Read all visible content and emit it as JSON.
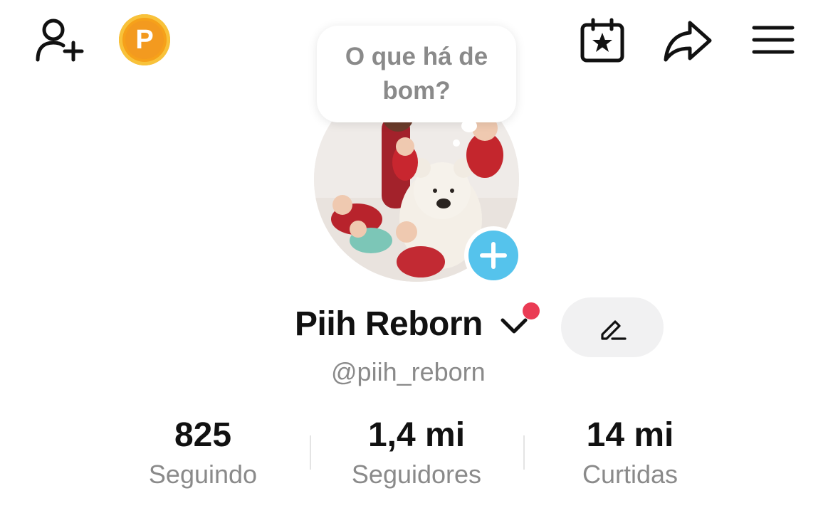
{
  "header": {
    "add_friend_icon": "add-user-icon",
    "coin_icon": "coin-p-icon",
    "coin_letter": "P",
    "calendar_icon": "calendar-star-icon",
    "share_icon": "share-arrow-icon",
    "menu_icon": "hamburger-menu-icon"
  },
  "bubble": {
    "text": "O que há de bom?"
  },
  "profile": {
    "display_name": "Piih Reborn",
    "handle": "@piih_reborn",
    "notification_dot_color": "#ea3b54",
    "add_button_color": "#55c3ec"
  },
  "stats": [
    {
      "value": "825",
      "label": "Seguindo"
    },
    {
      "value": "1,4 mi",
      "label": "Seguidores"
    },
    {
      "value": "14 mi",
      "label": "Curtidas"
    }
  ]
}
